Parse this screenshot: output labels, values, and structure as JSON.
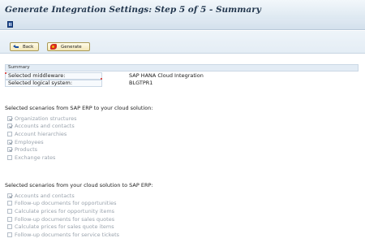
{
  "window": {
    "title": "Generate Integration Settings: Step 5 of 5 - Summary",
    "menu_icon": "menu-icon"
  },
  "toolbar": {
    "back_label": "Back",
    "back_icon": "back-arrow-icon",
    "generate_label": "Generate",
    "generate_icon": "generate-icon"
  },
  "summary": {
    "heading": "Summary",
    "rows": [
      {
        "label": "Selected middleware:",
        "value": "SAP HANA Cloud Integration"
      },
      {
        "label": "Selected logical system:",
        "value": "BLGTPR1"
      }
    ]
  },
  "sections": [
    {
      "title": "Selected scenarios from SAP ERP to your cloud solution:",
      "items": [
        {
          "label": "Organization structures",
          "checked": true
        },
        {
          "label": "Accounts and contacts",
          "checked": true
        },
        {
          "label": "Account hierarchies",
          "checked": false
        },
        {
          "label": "Employees",
          "checked": true
        },
        {
          "label": "Products",
          "checked": true
        },
        {
          "label": "Exchange rates",
          "checked": false
        }
      ]
    },
    {
      "title": "Selected scenarios from your cloud solution to SAP ERP:",
      "items": [
        {
          "label": "Accounts and contacts",
          "checked": true
        },
        {
          "label": "Follow-up documents for opportunities",
          "checked": false
        },
        {
          "label": "Calculate prices for opportunity items",
          "checked": false
        },
        {
          "label": "Follow-up documents for sales quotes",
          "checked": false
        },
        {
          "label": "Calculate prices for sales quote items",
          "checked": false
        },
        {
          "label": "Follow-up documents for service tickets",
          "checked": false
        }
      ]
    }
  ]
}
